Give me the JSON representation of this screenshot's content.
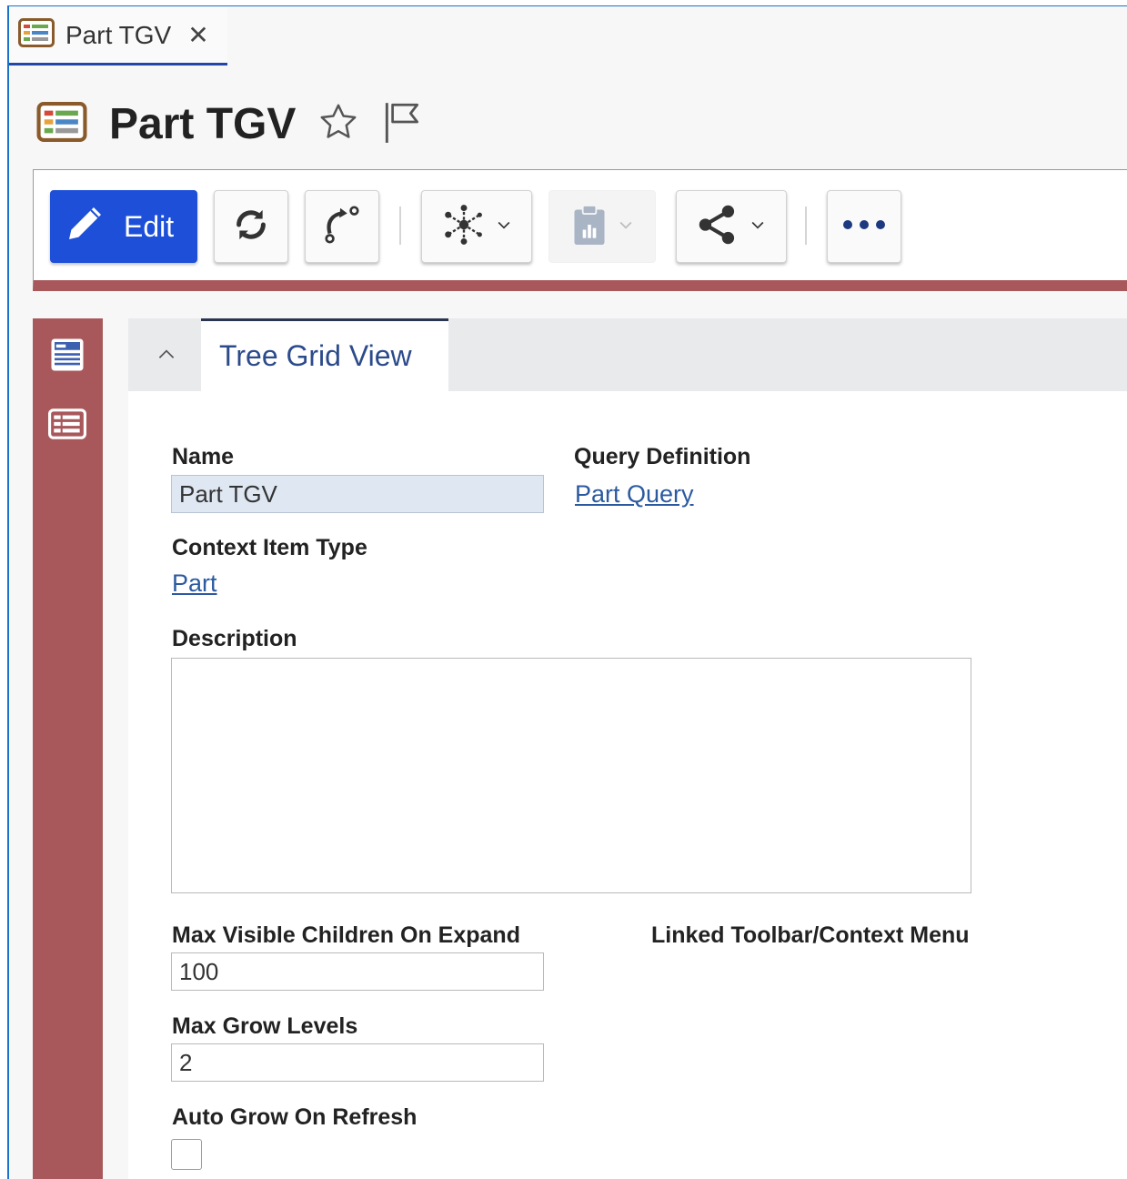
{
  "tab": {
    "label": "Part TGV",
    "close": "✕",
    "icon": "tree-grid-view-icon"
  },
  "header": {
    "title": "Part TGV",
    "star_icon": "star-icon",
    "flag_icon": "flag-icon"
  },
  "toolbar": {
    "edit_label": "Edit",
    "buttons": [
      "edit",
      "refresh",
      "promote",
      "structure-browser",
      "reports",
      "share",
      "more"
    ]
  },
  "panel": {
    "tab_label": "Tree Grid View"
  },
  "form": {
    "name": {
      "label": "Name",
      "value": "Part TGV"
    },
    "query_definition": {
      "label": "Query Definition",
      "value": "Part Query"
    },
    "context_item_type": {
      "label": "Context Item Type",
      "value": "Part"
    },
    "description": {
      "label": "Description",
      "value": ""
    },
    "max_visible_children": {
      "label": "Max Visible Children On Expand",
      "value": "100"
    },
    "linked_toolbar": {
      "label": "Linked Toolbar/Context Menu"
    },
    "max_grow_levels": {
      "label": "Max Grow Levels",
      "value": "2"
    },
    "auto_grow": {
      "label": "Auto Grow On Refresh",
      "checked": false
    }
  },
  "colors": {
    "accent": "#1d4fd8",
    "rail": "#a8585b",
    "link": "#2b5aa0"
  }
}
